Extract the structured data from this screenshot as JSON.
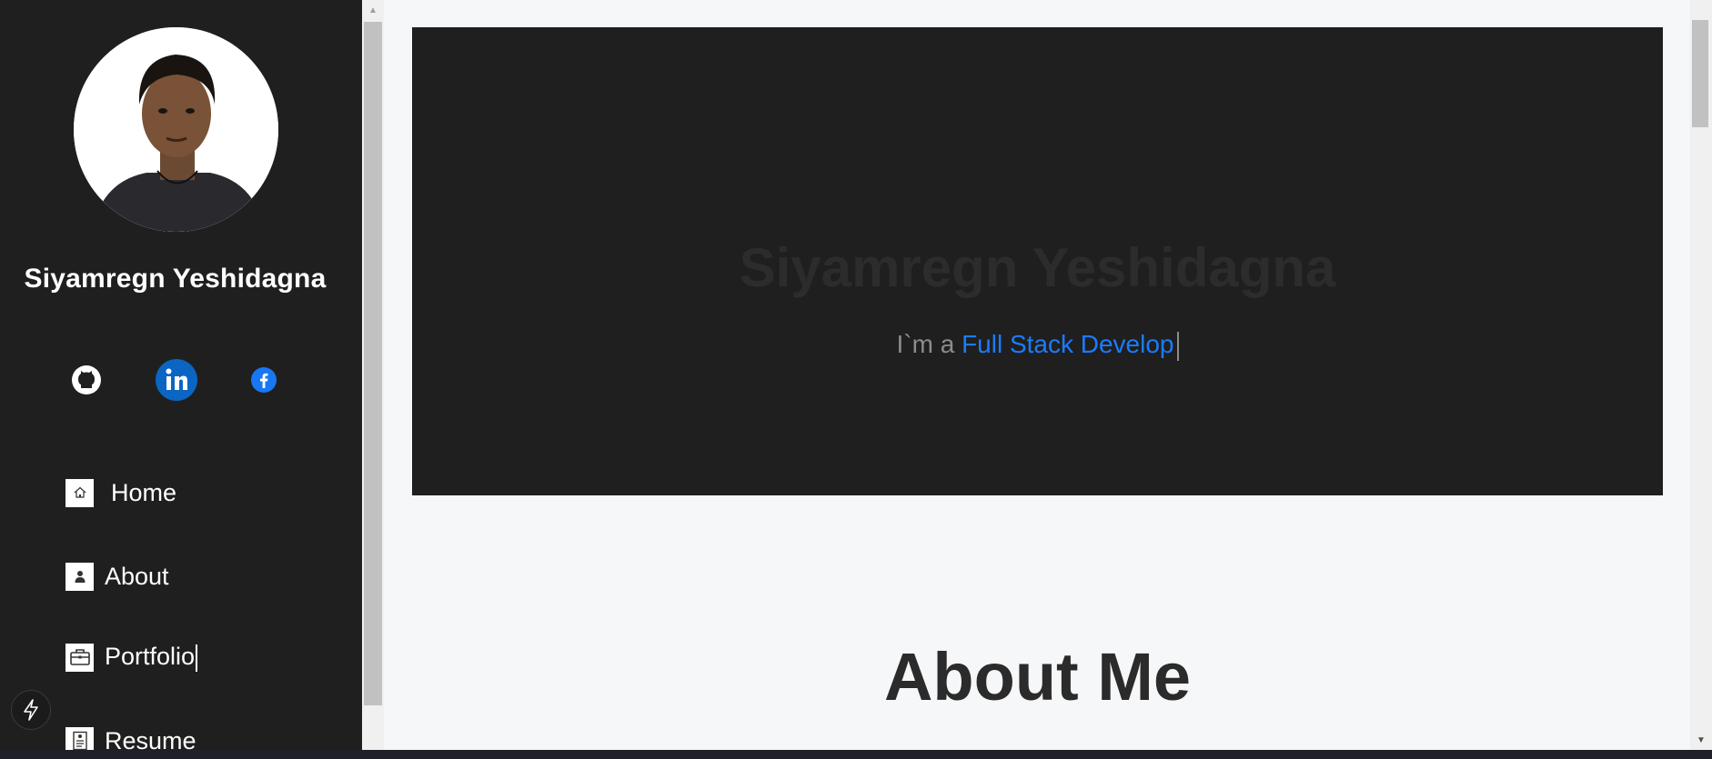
{
  "sidebar": {
    "name": "Siyamregn Yeshidagna",
    "social": [
      "github-icon",
      "linkedin-icon",
      "facebook-icon"
    ],
    "nav": [
      {
        "label": "Home",
        "icon": "home-icon"
      },
      {
        "label": "About",
        "icon": "user-icon"
      },
      {
        "label": "Portfolio",
        "icon": "briefcase-icon"
      },
      {
        "label": "Resume",
        "icon": "document-icon"
      }
    ]
  },
  "hero": {
    "name": "Siyamregn Yeshidagna",
    "tagline_prefix": "I`m a ",
    "tagline_role": "Full Stack Develop"
  },
  "about": {
    "heading": "About Me"
  },
  "colors": {
    "sidebar_bg": "#1f1f1f",
    "hero_bg": "#1f1f1f",
    "accent": "#1a7cff",
    "page_bg": "#f6f7f8"
  }
}
